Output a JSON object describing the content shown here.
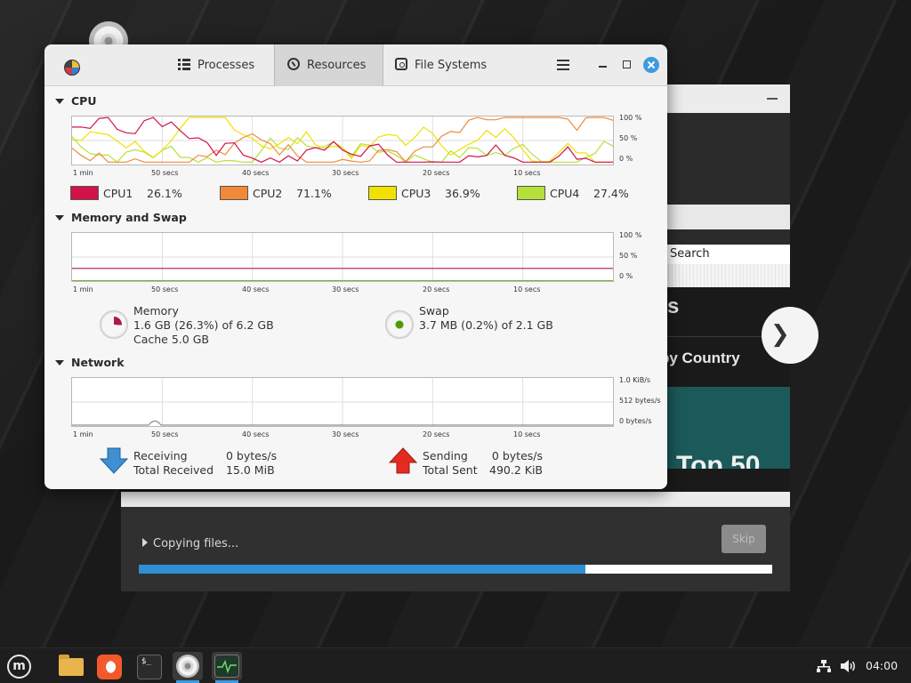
{
  "desktop": {
    "icons": [
      "disc-icon"
    ]
  },
  "installer": {
    "search_placeholder": "Search",
    "web_heading1": "ts",
    "web_heading2": "by Country",
    "web_banner": "Top 50",
    "status_label": "Copying files...",
    "skip_label": "Skip",
    "progress": 0.705
  },
  "sysmon": {
    "tabs": [
      {
        "label": "Processes",
        "icon": "list-icon"
      },
      {
        "label": "Resources",
        "icon": "gauge-icon",
        "active": true
      },
      {
        "label": "File Systems",
        "icon": "disk-icon"
      }
    ],
    "cpu": {
      "title": "CPU",
      "y_ticks": [
        "100 %",
        "50 %",
        "0 %"
      ],
      "x_ticks": [
        "1 min",
        "50 secs",
        "40 secs",
        "30 secs",
        "20 secs",
        "10 secs"
      ],
      "legend": [
        {
          "name": "CPU1",
          "value": "26.1%",
          "color": "#d3124a"
        },
        {
          "name": "CPU2",
          "value": "71.1%",
          "color": "#f08a3a"
        },
        {
          "name": "CPU3",
          "value": "36.9%",
          "color": "#f2e100"
        },
        {
          "name": "CPU4",
          "value": "27.4%",
          "color": "#b5e03a"
        }
      ]
    },
    "memory": {
      "title": "Memory and Swap",
      "y_ticks": [
        "100 %",
        "50 %",
        "0 %"
      ],
      "x_ticks": [
        "1 min",
        "50 secs",
        "40 secs",
        "30 secs",
        "20 secs",
        "10 secs"
      ],
      "memory_label": "Memory",
      "memory_value": "1.6 GB (26.3%) of 6.2 GB",
      "cache_value": "Cache 5.0 GB",
      "memory_color": "#ab1852",
      "memory_fraction": 0.263,
      "swap_label": "Swap",
      "swap_value": "3.7 MB (0.2%) of 2.1 GB",
      "swap_color": "#4e9a06",
      "swap_fraction": 0.002
    },
    "network": {
      "title": "Network",
      "y_ticks": [
        "1.0 KiB/s",
        "512 bytes/s",
        "0 bytes/s"
      ],
      "x_ticks": [
        "1 min",
        "50 secs",
        "40 secs",
        "30 secs",
        "20 secs",
        "10 secs"
      ],
      "receiving_label": "Receiving",
      "receiving_value": "0 bytes/s",
      "total_received_label": "Total Received",
      "total_received_value": "15.0 MiB",
      "sending_label": "Sending",
      "sending_value": "0 bytes/s",
      "total_sent_label": "Total Sent",
      "total_sent_value": "490.2 KiB"
    }
  },
  "taskbar": {
    "apps": [
      "mint-menu-icon",
      "files-icon",
      "firefox-icon",
      "terminal-icon",
      "disc-icon",
      "system-monitor-icon"
    ],
    "active_app": "system-monitor-icon",
    "terminal_glyph": "$_",
    "clock": "04:00"
  }
}
